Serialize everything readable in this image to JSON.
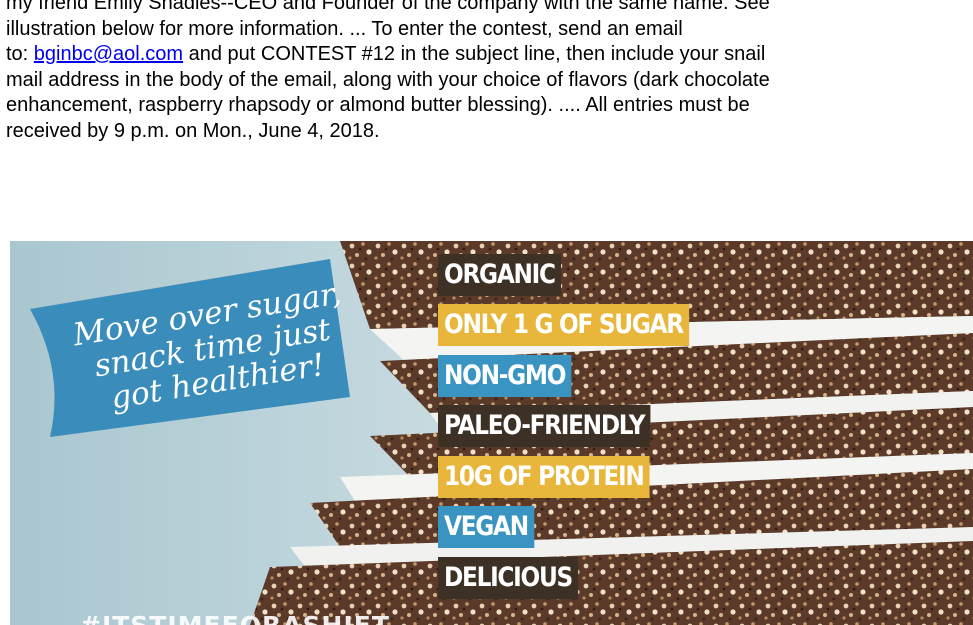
{
  "article": {
    "line1": "my friend Emily Shadles--CEO and Founder of the company with the same name. See",
    "line2": "illustration below for more information. ... To enter the contest, send an email",
    "line3_prefix": "to: ",
    "email_link": "bginbc@aol.com",
    "line3_suffix": " and put CONTEST #12 in the subject line, then include your snail",
    "line4": "mail address in the body of the email, along with your choice of flavors (dark chocolate",
    "line5": "enhancement, raspberry rhapsody or almond butter blessing). .... All entries must be",
    "line6": "received by 9 p.m. on Mon., June 4, 2018."
  },
  "promo": {
    "banner": {
      "line1": "Move over sugar,",
      "line2": "snack time just",
      "line3": "got healthier!"
    },
    "hashtag": "#ITSTIMEFORASHIFT",
    "claims": [
      {
        "text": "ORGANIC",
        "bg": "#3d3126",
        "fg": "#ffffff"
      },
      {
        "text": "ONLY 1 G OF SUGAR",
        "bg": "#e7b63b",
        "fg": "#ffffff"
      },
      {
        "text": "NON-GMO",
        "bg": "#3a94c1",
        "fg": "#ffffff"
      },
      {
        "text": "PALEO-FRIENDLY",
        "bg": "#3d3126",
        "fg": "#ffffff"
      },
      {
        "text": "10G OF PROTEIN",
        "bg": "#e7b63b",
        "fg": "#ffffff"
      },
      {
        "text": "VEGAN",
        "bg": "#3a94c1",
        "fg": "#ffffff"
      },
      {
        "text": "DELICIOUS",
        "bg": "#3d3126",
        "fg": "#ffffff"
      }
    ],
    "colors": {
      "banner_blue": "#3a8dbb",
      "bar_brown": "#5b3a2a",
      "paper": "#f4f4f2"
    }
  }
}
